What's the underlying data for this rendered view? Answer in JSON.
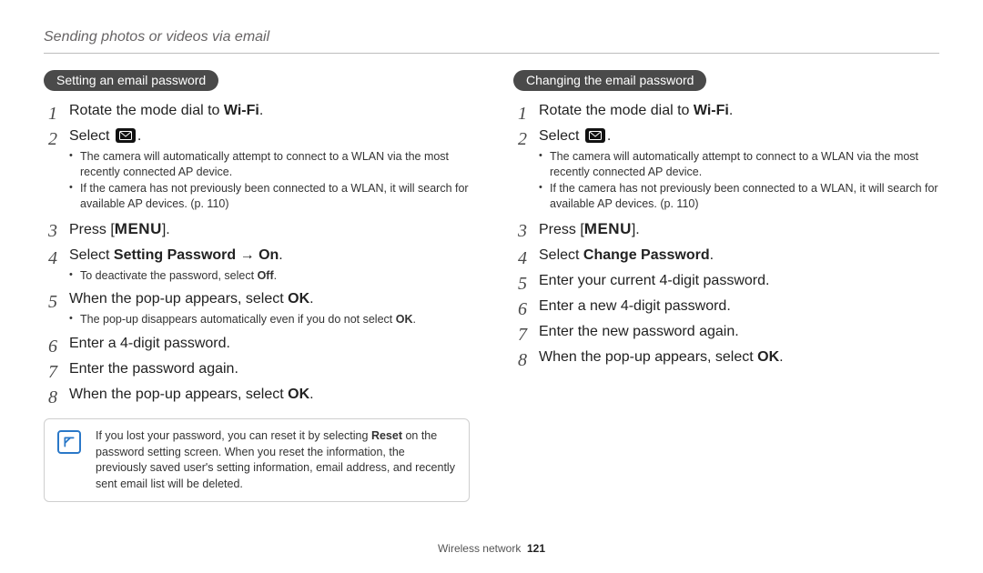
{
  "header": "Sending photos or videos via email",
  "left": {
    "pill": "Setting an email password",
    "step1_pre": "Rotate the mode dial to ",
    "step1_wifi": "Wi-Fi",
    "step1_post": ".",
    "step2_pre": "Select ",
    "step2_post": ".",
    "step2_sub1": "The camera will automatically attempt to connect to a WLAN via the most recently connected AP device.",
    "step2_sub2": "If the camera has not previously been connected to a WLAN, it will search for available AP devices. (p. 110)",
    "step3_pre": "Press [",
    "step3_menu": "MENU",
    "step3_post": "].",
    "step4_pre": "Select ",
    "step4_bold": "Setting Password → On",
    "step4_post": ".",
    "step4_sub1_pre": "To deactivate the password, select ",
    "step4_sub1_bold": "Off",
    "step4_sub1_post": ".",
    "step5_pre": "When the pop-up appears, select ",
    "step5_bold": "OK",
    "step5_post": ".",
    "step5_sub1_pre": "The pop-up disappears automatically even if you do not select ",
    "step5_sub1_bold": "OK",
    "step5_sub1_post": ".",
    "step6": "Enter a 4-digit password.",
    "step7": "Enter the password again.",
    "step8_pre": "When the pop-up appears, select ",
    "step8_bold": "OK",
    "step8_post": ".",
    "note_pre": "If you lost your password, you can reset it by selecting ",
    "note_bold": "Reset",
    "note_post": " on the password setting screen. When you reset the information, the previously saved user's setting information, email address, and recently sent email list will be deleted."
  },
  "right": {
    "pill": "Changing the email password",
    "step1_pre": "Rotate the mode dial to ",
    "step1_wifi": "Wi-Fi",
    "step1_post": ".",
    "step2_pre": "Select ",
    "step2_post": ".",
    "step2_sub1": "The camera will automatically attempt to connect to a WLAN via the most recently connected AP device.",
    "step2_sub2": "If the camera has not previously been connected to a WLAN, it will search for available AP devices. (p. 110)",
    "step3_pre": "Press [",
    "step3_menu": "MENU",
    "step3_post": "].",
    "step4_pre": "Select ",
    "step4_bold": "Change Password",
    "step4_post": ".",
    "step5": "Enter your current 4-digit password.",
    "step6": "Enter a new 4-digit password.",
    "step7": "Enter the new password again.",
    "step8_pre": "When the pop-up appears, select ",
    "step8_bold": "OK",
    "step8_post": "."
  },
  "footer_label": "Wireless network",
  "footer_page": "121"
}
